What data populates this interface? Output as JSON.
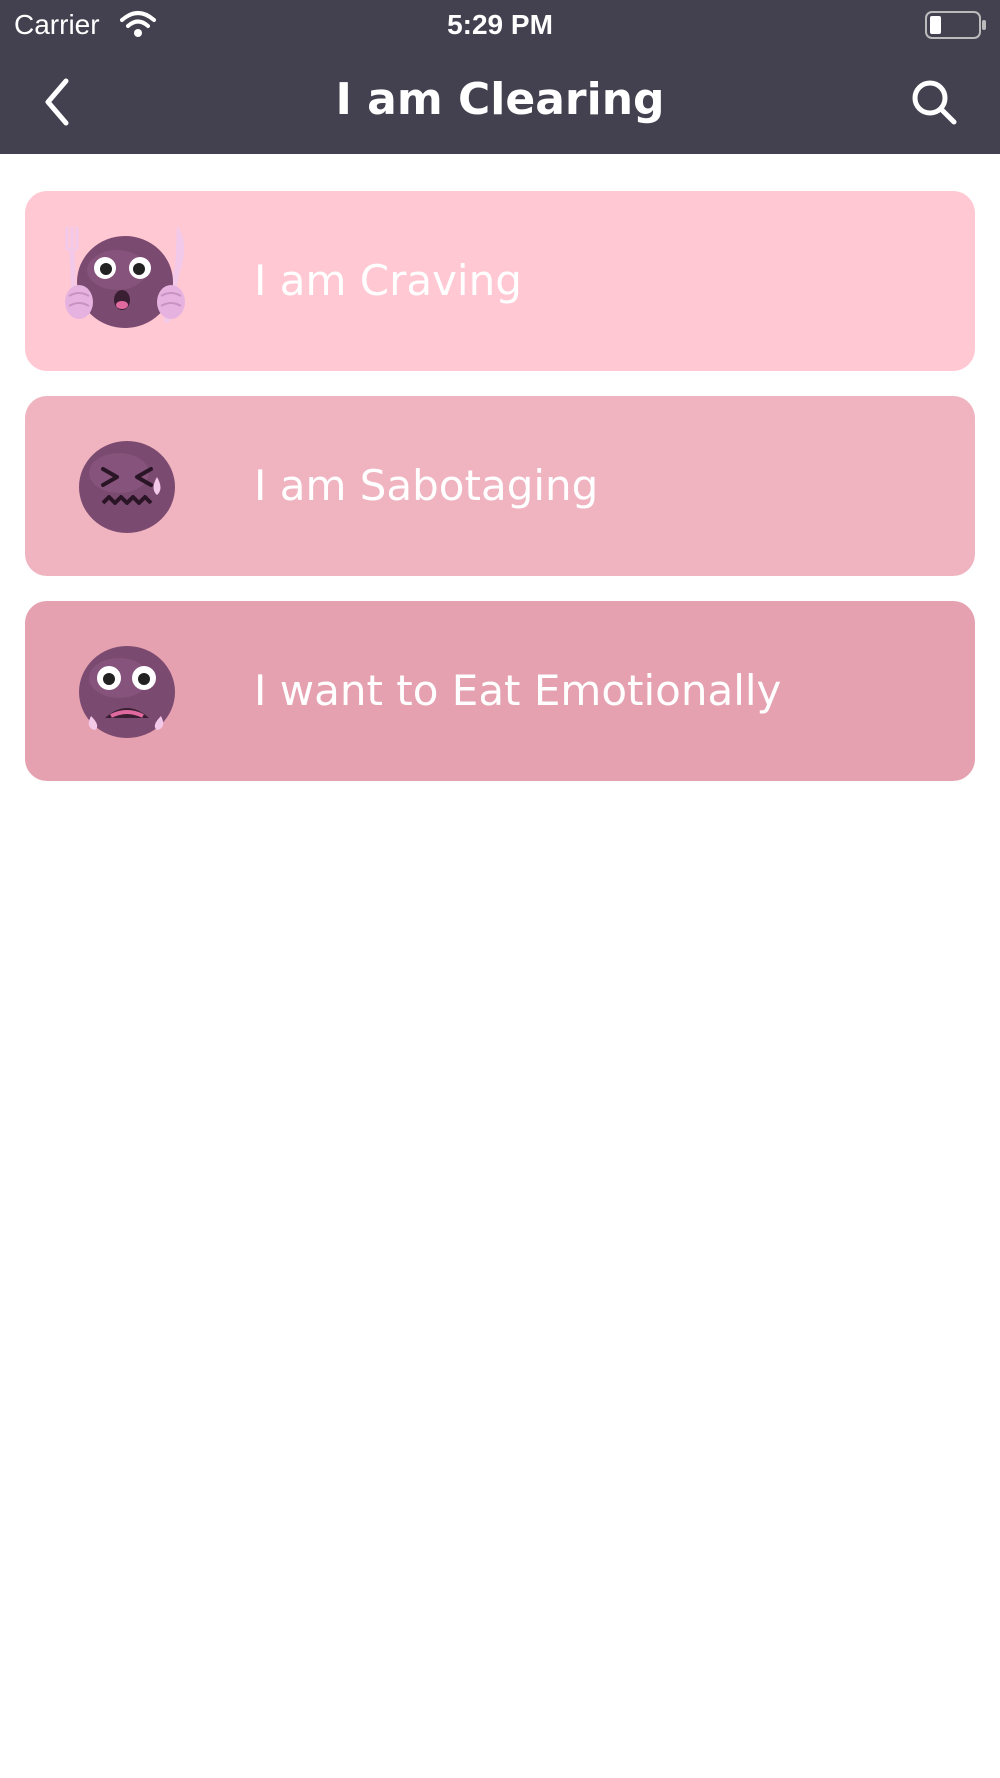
{
  "status_bar": {
    "carrier": "Carrier",
    "time": "5:29 PM",
    "wifi_icon": "wifi-icon",
    "battery_icon": "battery-low-icon"
  },
  "nav": {
    "title": "I am Clearing",
    "back_icon": "chevron-left-icon",
    "search_icon": "search-icon"
  },
  "colors": {
    "nav_background": "#43414f",
    "face": "#7b4a70",
    "card_1": "#ffc8d3",
    "card_2": "#f0b3c0",
    "card_3": "#e6a1b0"
  },
  "items": [
    {
      "label": "I am Craving",
      "icon": "craving-emoji-icon"
    },
    {
      "label": "I am Sabotaging",
      "icon": "sabotaging-emoji-icon"
    },
    {
      "label": "I want to Eat Emotionally",
      "icon": "sad-emoji-icon"
    }
  ]
}
